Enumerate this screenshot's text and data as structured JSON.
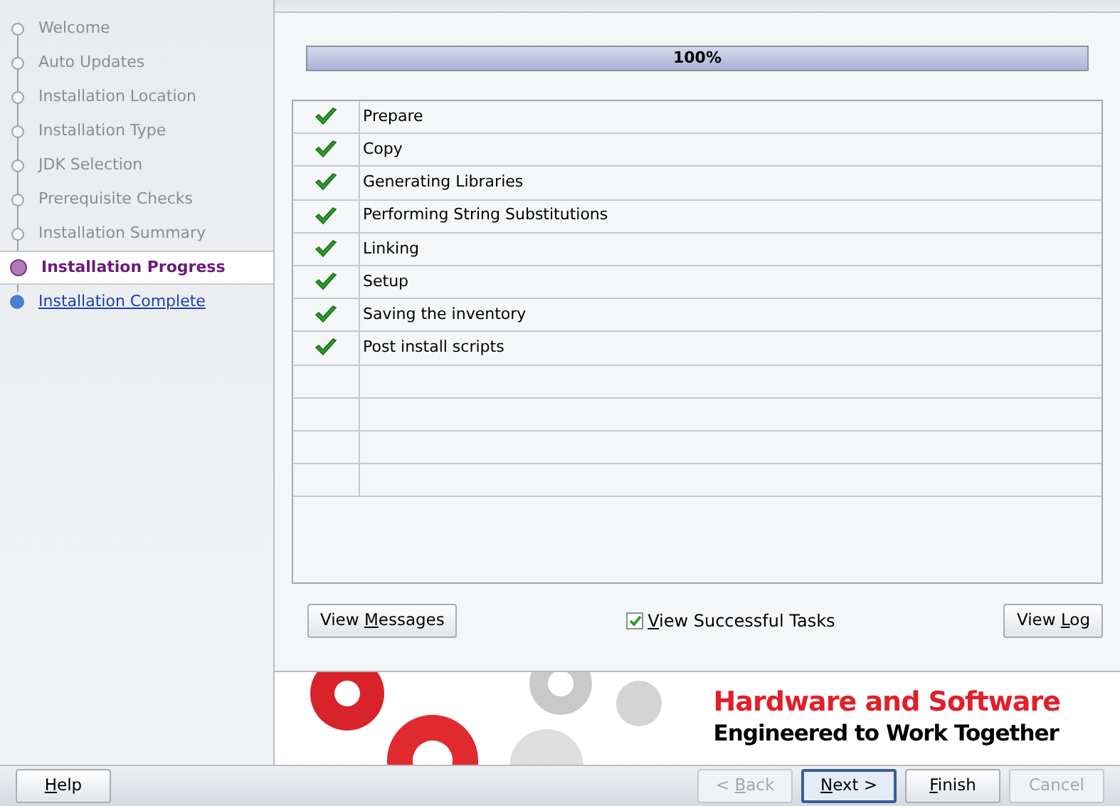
{
  "sidebar": {
    "steps": [
      {
        "label": "Welcome",
        "done": true,
        "selected": false
      },
      {
        "label": "Auto Updates",
        "done": true,
        "selected": false
      },
      {
        "label": "Installation Location",
        "done": true,
        "selected": false
      },
      {
        "label": "Installation Type",
        "done": true,
        "selected": false
      },
      {
        "label": "JDK Selection",
        "done": true,
        "selected": false
      },
      {
        "label": "Prerequisite Checks",
        "done": true,
        "selected": false
      },
      {
        "label": "Installation Summary",
        "done": true,
        "selected": false
      },
      {
        "label": "Installation Progress",
        "done": false,
        "selected": true
      },
      {
        "label": "Installation Complete",
        "done": false,
        "selected": false
      }
    ]
  },
  "progress": {
    "reading": "100%",
    "level": 1
  },
  "tasks": [
    {
      "name": "Prepare",
      "done": true
    },
    {
      "name": "Copy",
      "done": true
    },
    {
      "name": "Generating Libraries",
      "done": true
    },
    {
      "name": "Performing String Substitutions",
      "done": true
    },
    {
      "name": "Linking",
      "done": true
    },
    {
      "name": "Setup",
      "done": true
    },
    {
      "name": "Saving the inventory",
      "done": true
    },
    {
      "name": "Post install scripts",
      "done": true
    }
  ],
  "view_messages_button": {
    "before": "View ",
    "key": "M",
    "after": "essages"
  },
  "view_successful_tasks": {
    "key": "V",
    "after": "iew Successful Tasks",
    "checked": true
  },
  "view_log_button": {
    "before": "View ",
    "key": "L",
    "after": "og"
  },
  "banner": {
    "headline": "Hardware and Software",
    "tagline": "Engineered to Work Together"
  },
  "footer": {
    "help": {
      "key": "H",
      "after": "elp"
    },
    "buttons": [
      {
        "before": "< ",
        "key": "B",
        "after": "ack",
        "disabled": true,
        "focused": false
      },
      {
        "key": "N",
        "after": "ext >",
        "disabled": false,
        "focused": true
      },
      {
        "key": "F",
        "after": "inish",
        "disabled": false,
        "focused": false
      },
      {
        "before": "Cancel",
        "disabled": true,
        "focused": false
      }
    ]
  }
}
